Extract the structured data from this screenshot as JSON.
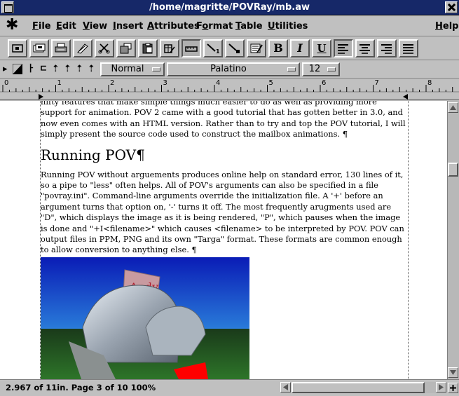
{
  "window": {
    "title": "/home/magritte/POVRay/mb.aw"
  },
  "menu": {
    "app_icon": "✱",
    "items": [
      {
        "label": "File",
        "mnemonic": "F"
      },
      {
        "label": "Edit",
        "mnemonic": "E"
      },
      {
        "label": "View",
        "mnemonic": "V"
      },
      {
        "label": "Insert",
        "mnemonic": "I"
      },
      {
        "label": "Attributes",
        "mnemonic": "A"
      },
      {
        "label": "Format",
        "mnemonic": "o"
      },
      {
        "label": "Table",
        "mnemonic": "T"
      },
      {
        "label": "Utilities",
        "mnemonic": "U"
      },
      {
        "label": "Help",
        "mnemonic": "H"
      }
    ]
  },
  "toolbar": {
    "bold_label": "B",
    "italic_label": "I",
    "underline_label": "U",
    "icons": [
      "new-document-icon",
      "open-document-icon",
      "print-icon",
      "spellcheck-icon",
      "cut-icon",
      "copy-icon",
      "paste-icon",
      "insert-table-icon",
      "ruler-icon",
      "line-icon",
      "frame-icon",
      "notes-icon",
      "bold-icon",
      "italic-icon",
      "underline-icon",
      "align-left-icon",
      "align-center-icon",
      "align-right-icon",
      "justify-icon"
    ],
    "active_alignment": "left"
  },
  "format_bar": {
    "style": "Normal",
    "font": "Palatino",
    "size": "12"
  },
  "ruler": {
    "numbers": [
      "0",
      "1",
      "2",
      "3",
      "4",
      "5",
      "6",
      "7",
      "8"
    ]
  },
  "document": {
    "para1": "nifty features that make simple things much easier to do as well as providing more support for animation. POV 2 came with a good tutorial that has gotten better in 3.0, and now even comes with an HTML version.  Rather than to try and top the POV tutorial, I will simply present the source code used to construct the mailbox animations. ¶",
    "heading": "Running POV¶",
    "para2": "Running POV without arguements produces online help on standard error, 130 lines of it, so a pipe to \"less\" often helps.  All of POV's arguments can also be specified in a file \"povray.ini\".  Command-line arguments override the initialization file.  A '+' before an argument turns that option on, '-' turns it off.  The most frequently arugments used are \"D\", which displays the image as it is being rendered, \"P\", which pauses when the image is done and \"+I<filename>\" which causes <filename> to be interpreted by POV.  POV can output files in PPM, PNG and its own \"Targa\" format.  These formats are common enough to allow conversion to anything else. ¶",
    "image_flag_text": "Andy"
  },
  "status": {
    "text": "2.967 of 11in.  Page 3 of 10  100%"
  },
  "colors": {
    "title_bg": "#162868",
    "chrome": "#c0c0c0",
    "page": "#ffffff"
  }
}
